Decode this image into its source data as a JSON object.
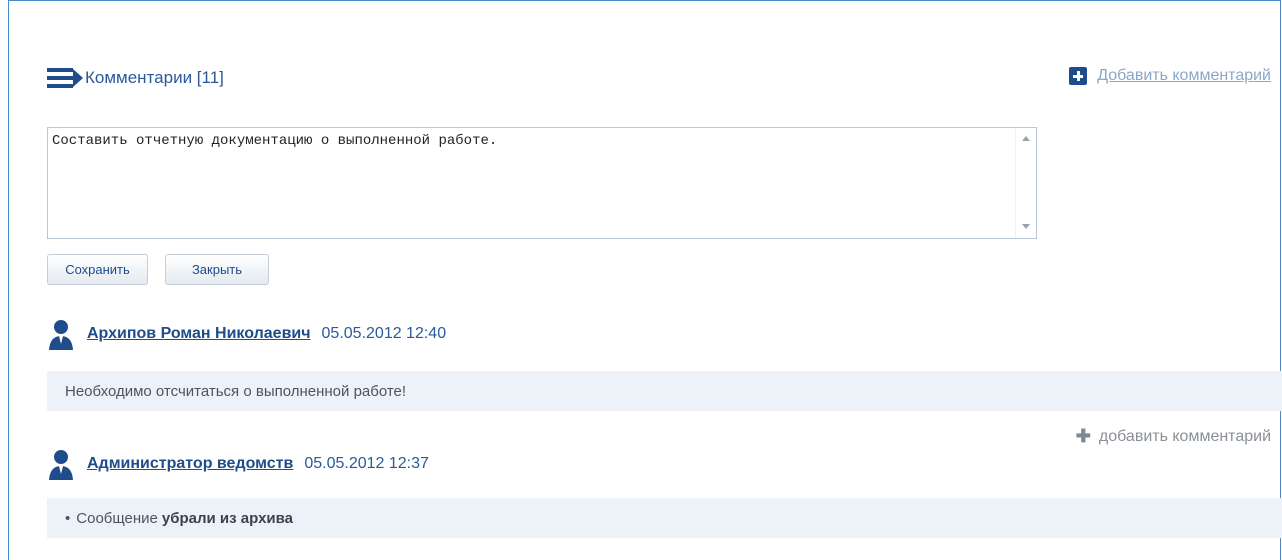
{
  "comments_section": {
    "title": "Комментарии [11]",
    "add_comment_label": "Добавить комментарий"
  },
  "editor": {
    "value": "Составить отчетную документацию о выполненной работе."
  },
  "buttons": {
    "save_label": "Сохранить",
    "close_label": "Закрыть"
  },
  "comments": [
    {
      "author": "Архипов Роман Николаевич",
      "date": "05.05.2012 12:40",
      "text": "Необходимо отсчитаться о выполненной работе!",
      "reply_label": "добавить комментарий"
    },
    {
      "author": "Администратор ведомств",
      "date": "05.05.2012 12:37",
      "text_prefix": "Сообщение",
      "text_strong": "убрали из архива"
    }
  ],
  "icons": {
    "comments": "comments-list-icon",
    "add": "add-square-icon",
    "user": "user-avatar-icon",
    "reply_add": "plus-icon"
  },
  "colors": {
    "frame_border": "#4a8ac9",
    "link": "#1f4c8a",
    "muted_link": "#8aa8c8",
    "comment_bg": "#edf2f8"
  }
}
